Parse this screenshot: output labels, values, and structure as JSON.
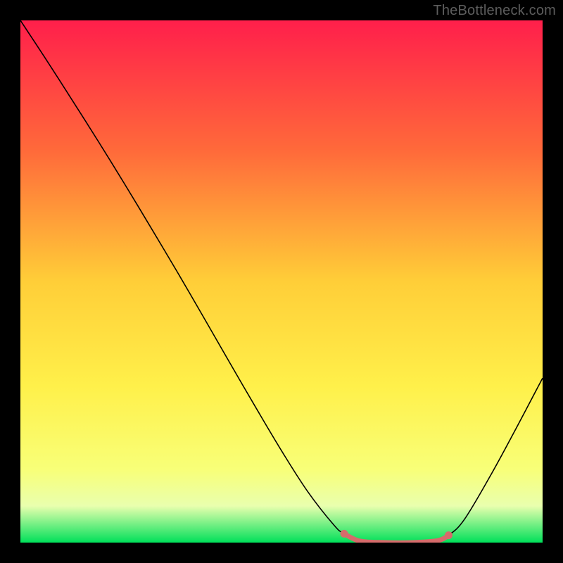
{
  "watermark": "TheBottleneck.com",
  "chart_data": {
    "type": "line",
    "title": "",
    "xlabel": "",
    "ylabel": "",
    "xlim": [
      0,
      100
    ],
    "ylim": [
      0,
      100
    ],
    "grid": false,
    "legend": false,
    "gradient_stops": [
      {
        "offset": 0,
        "color": "#ff1f4b"
      },
      {
        "offset": 25,
        "color": "#ff6a3a"
      },
      {
        "offset": 50,
        "color": "#ffce38"
      },
      {
        "offset": 70,
        "color": "#fff04a"
      },
      {
        "offset": 86,
        "color": "#f8ff78"
      },
      {
        "offset": 93,
        "color": "#e9ffae"
      },
      {
        "offset": 100,
        "color": "#00e05a"
      }
    ],
    "series": [
      {
        "name": "bottleneck-curve",
        "color": "#000000",
        "width": 1.6,
        "x": [
          0,
          5,
          10,
          15,
          20,
          25,
          30,
          35,
          40,
          45,
          50,
          55,
          60,
          62,
          65,
          70,
          75,
          80,
          82,
          85,
          90,
          95,
          100
        ],
        "y": [
          100,
          92.4,
          84.6,
          76.7,
          68.6,
          60.3,
          51.9,
          43.3,
          34.6,
          26.0,
          17.6,
          9.8,
          3.4,
          1.7,
          0.3,
          0.0,
          0.0,
          0.4,
          1.4,
          4.4,
          12.8,
          22.0,
          31.5
        ]
      }
    ],
    "highlight": {
      "name": "optimal-zone",
      "color": "#d66b6b",
      "stroke_width": 7,
      "dot_radius": 5.5,
      "x": [
        62,
        65,
        70,
        75,
        80,
        82
      ],
      "y": [
        1.7,
        0.3,
        0.0,
        0.0,
        0.4,
        1.4
      ]
    }
  }
}
